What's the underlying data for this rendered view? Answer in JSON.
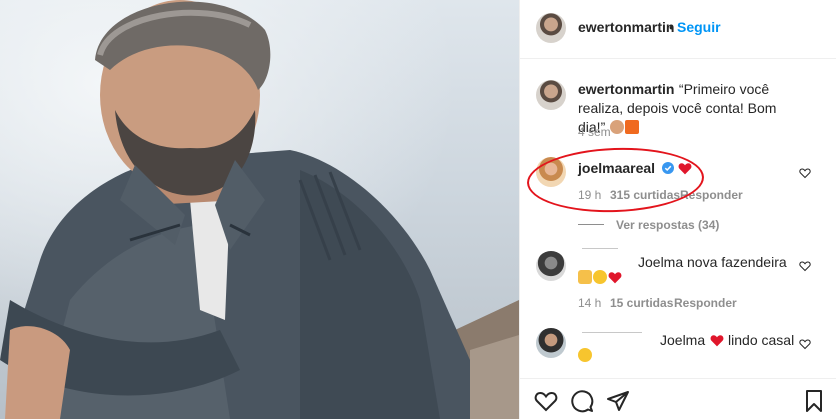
{
  "post": {
    "author": "ewertonmartin",
    "separator": "•",
    "follow_label": "Seguir"
  },
  "caption": {
    "username": "ewertonmartin",
    "text": "“Primeiro você realiza, depois você conta! Bom dia!”",
    "time": "4 sem"
  },
  "comments": [
    {
      "username": "joelmaareal",
      "verified": true,
      "time": "19 h",
      "likes": "315 curtidas",
      "reply_label": "Responder",
      "view_replies": "Ver respostas (34)"
    },
    {
      "text": "Joelma nova fazendeira",
      "time": "14 h",
      "likes": "15 curtidas",
      "reply_label": "Responder"
    },
    {
      "text_before": "Joelma",
      "text_after": "lindo casal"
    }
  ],
  "colors": {
    "link_blue": "#0095f6",
    "verified_blue": "#3897f0",
    "heart_red": "#ed4956",
    "annotation_red": "#e3141c"
  },
  "icons": [
    "heart-icon",
    "comment-icon",
    "share-icon",
    "bookmark-icon",
    "verified-badge-icon"
  ]
}
